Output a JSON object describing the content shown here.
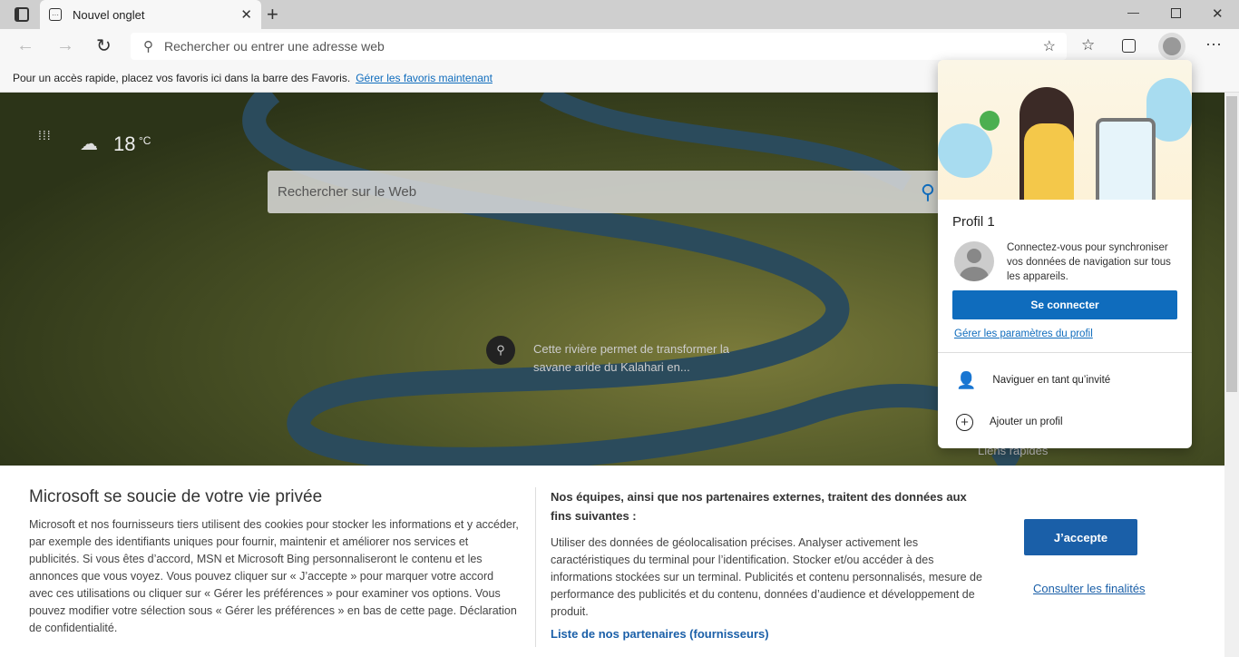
{
  "tab": {
    "title": "Nouvel onglet"
  },
  "address": {
    "placeholder": "Rechercher ou entrer une adresse web"
  },
  "favbar": {
    "text": "Pour un accès rapide, placez vos favoris ici dans la barre des Favoris.",
    "link": "Gérer les favoris maintenant"
  },
  "weather": {
    "temp": "18",
    "unit": "°C"
  },
  "search": {
    "placeholder": "Rechercher sur le Web"
  },
  "caption": "Cette rivière permet de transformer la savane aride du Kalahari en...",
  "quick_links": "Liens rapides",
  "profile": {
    "name": "Profil 1",
    "sync_text": "Connectez-vous pour synchroniser vos données de navigation sur tous les appareils.",
    "signin": "Se connecter",
    "manage": "Gérer les paramètres du profil",
    "guest": "Naviguer en tant qu’invité",
    "add": "Ajouter un profil"
  },
  "privacy": {
    "title": "Microsoft se soucie de votre vie privée",
    "body": "Microsoft et nos fournisseurs tiers utilisent des cookies pour stocker les informations et y accéder, par exemple des identifiants uniques pour fournir, maintenir et améliorer nos services et publicités. Si vous êtes d’accord, MSN et Microsoft Bing personnaliseront le contenu et les annonces que vous voyez. Vous pouvez cliquer sur « J’accepte » pour marquer votre accord avec ces utilisations ou cliquer sur « Gérer les préférences » pour examiner vos options. Vous pouvez modifier votre sélection sous « Gérer les préférences » en bas de cette page.",
    "link": "Déclaration de confidentialité.",
    "purposes_title": "Nos équipes, ainsi que nos partenaires externes, traitent des données aux fins suivantes :",
    "purposes": "Utiliser des données de géolocalisation précises. Analyser activement les caractéristiques du terminal pour l’identification. Stocker et/ou accéder à des informations stockées sur un terminal. Publicités et contenu personnalisés, mesure de performance des publicités et du contenu, données d’audience et développement de produit.",
    "partners": "Liste de nos partenaires (fournisseurs)",
    "accept": "J’accepte",
    "consult": "Consulter les finalités"
  },
  "colors": {
    "accent": "#0f6cbd"
  }
}
